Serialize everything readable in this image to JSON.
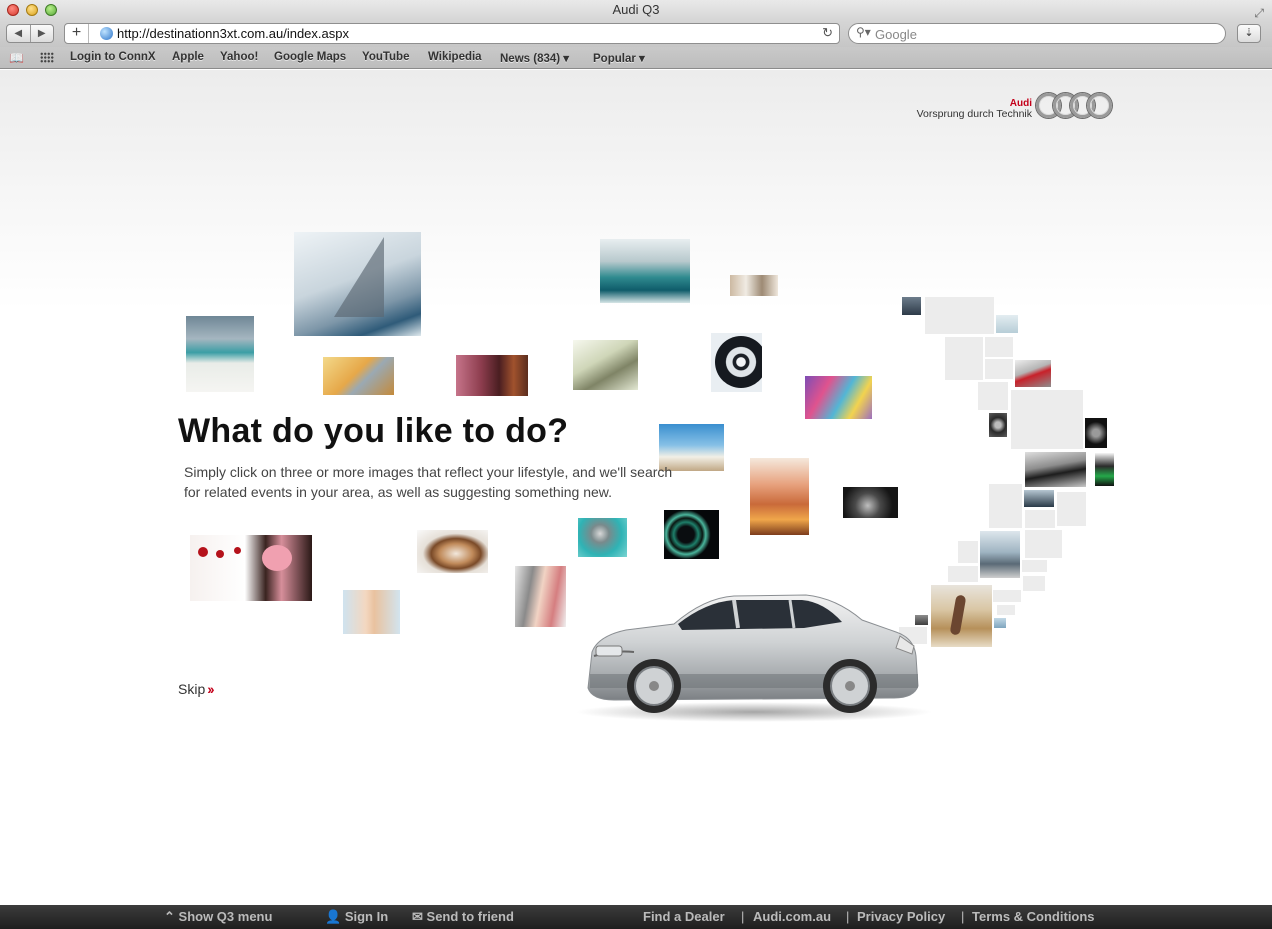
{
  "window": {
    "title": "Audi Q3"
  },
  "toolbar": {
    "url": "http://destinationn3xt.com.au/index.aspx",
    "search_placeholder": "Google"
  },
  "bookmarks": [
    "Login to ConnX",
    "Apple",
    "Yahoo!",
    "Google Maps",
    "YouTube",
    "Wikipedia",
    "News (834) ▾",
    "Popular ▾"
  ],
  "brand": {
    "name": "Audi",
    "slogan": "Vorsprung durch Technik"
  },
  "main": {
    "headline": "What do you like to do?",
    "subtext": "Simply click on three or more images that reflect your lifestyle, and we'll search for related events in your area, as well as suggesting something new.",
    "skip_label": "Skip"
  },
  "footer": {
    "show_menu": "Show Q3 menu",
    "sign_in": "Sign In",
    "send_to_friend": "Send to friend",
    "links": [
      "Find a Dealer",
      "Audi.com.au",
      "Privacy Policy",
      "Terms & Conditions"
    ]
  },
  "icons": {
    "brand_accent": "#c4001a"
  }
}
